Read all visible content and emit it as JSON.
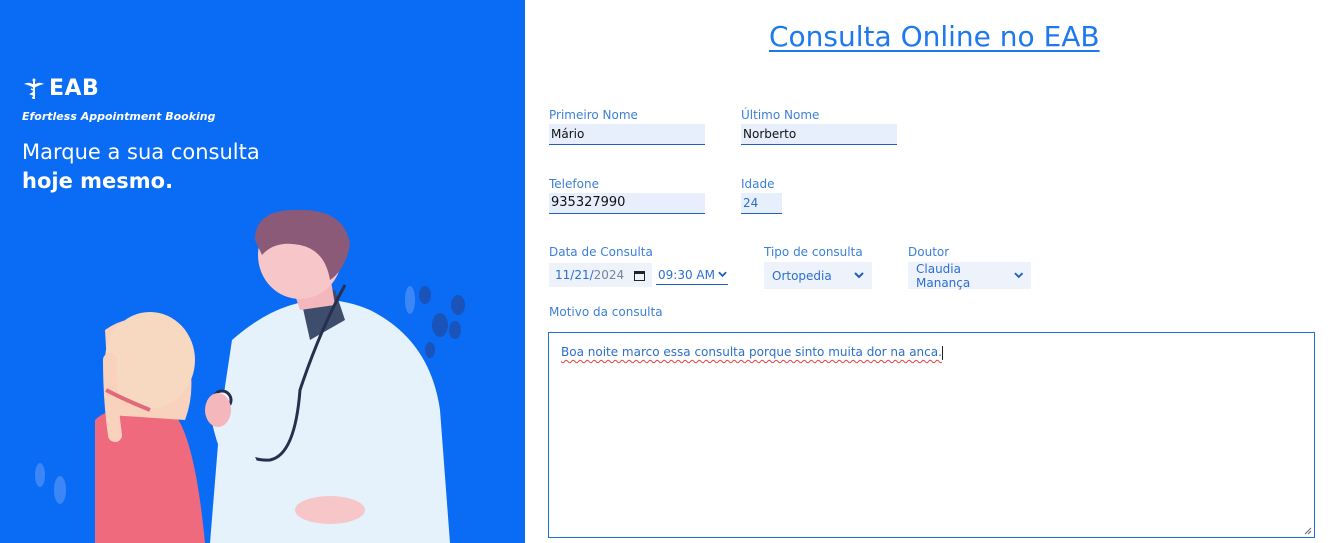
{
  "brand": {
    "name": "EAB",
    "tagline": "Efortless Appointment Booking",
    "logo_icon": "caduceus-icon"
  },
  "hero": {
    "headline_line1": "Marque a sua consulta",
    "headline_line2": "hoje mesmo."
  },
  "form": {
    "title": "Consulta Online no EAB",
    "first_name": {
      "label": "Primeiro Nome",
      "value": "Mário"
    },
    "last_name": {
      "label": "Último Nome",
      "value": "Norberto"
    },
    "phone": {
      "label": "Telefone",
      "value": "935327990"
    },
    "age": {
      "label": "Idade",
      "value": "24"
    },
    "date": {
      "label": "Data de Consulta",
      "month_day": "11/21/",
      "year": "2024",
      "time": "09:30 AM"
    },
    "consult_type": {
      "label": "Tipo de consulta",
      "value": "Ortopedia"
    },
    "doctor": {
      "label": "Doutor",
      "value": "Claudia Manança"
    },
    "reason": {
      "label": "Motivo da consulta",
      "value": "Boa noite marco essa consulta porque sinto muita dor na anca."
    }
  },
  "colors": {
    "hero_bg": "#0a6cf5",
    "accent": "#1e78ef",
    "field_bg": "#e8effc"
  }
}
